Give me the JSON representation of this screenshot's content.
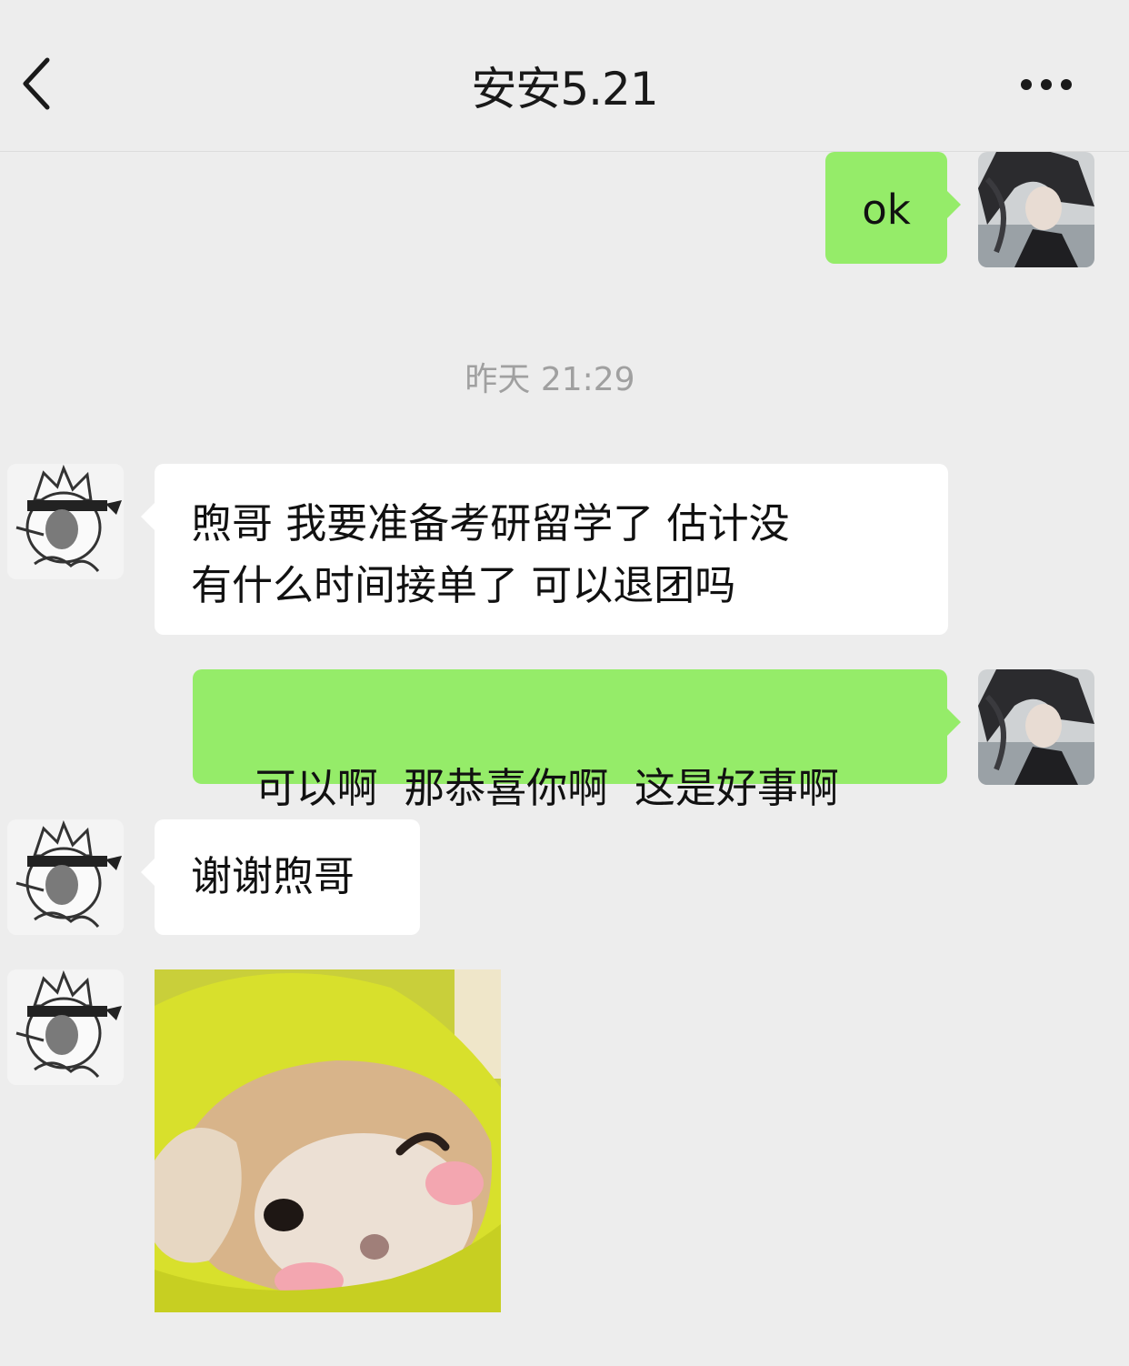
{
  "header": {
    "title": "安安5.21"
  },
  "messages": {
    "m1": {
      "text": "ok"
    },
    "timestamp": "昨天 21:29",
    "m2": {
      "line1": "煦哥 我要准备考研留学了 估计没",
      "line2": "有什么时间接单了 可以退团吗"
    },
    "m3": {
      "text": "可以啊  那恭喜你啊  这是好事啊"
    },
    "m4": {
      "text": "谢谢煦哥"
    }
  },
  "icons": {
    "back": "chevron-left-icon",
    "more": "more-dots-icon"
  },
  "colors": {
    "background": "#ededed",
    "sent_bubble": "#95ec69",
    "received_bubble": "#ffffff",
    "timestamp_text": "#a0a0a0"
  }
}
